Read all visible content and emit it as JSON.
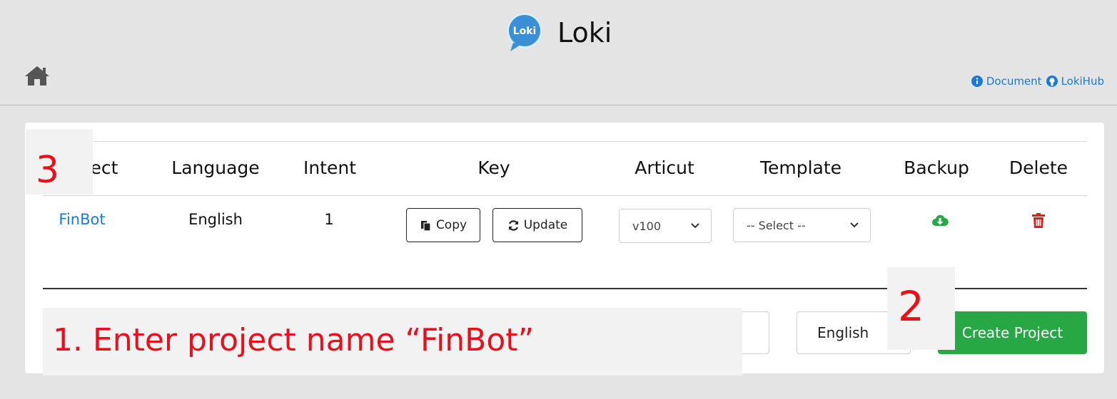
{
  "app": {
    "title": "Loki",
    "logo_text": "Loki",
    "brand_color": "#3a8fd6"
  },
  "nav": {
    "home_icon": "home-icon",
    "links": [
      {
        "label": "Document",
        "icon": "info-circle-icon"
      },
      {
        "label": "LokiHub",
        "icon": "github-icon"
      }
    ]
  },
  "table": {
    "headers": [
      "ect",
      "Language",
      "Intent",
      "Key",
      "Articut",
      "Template",
      "Backup",
      "Delete"
    ],
    "row": {
      "project": "FinBot",
      "language": "English",
      "intent": "1",
      "copy_label": "Copy",
      "update_label": "Update",
      "articut_value": "v100",
      "template_value": "-- Select --",
      "backup_icon": "cloud-download-icon",
      "delete_icon": "trash-icon"
    }
  },
  "create_form": {
    "name_value": "",
    "language_value": "English",
    "submit_label": "Create Project",
    "submit_color": "#28a745"
  },
  "annotations": {
    "step1": "1. Enter project name “FinBot”",
    "step2": "2",
    "step3": "3",
    "color": "#e8101a"
  }
}
